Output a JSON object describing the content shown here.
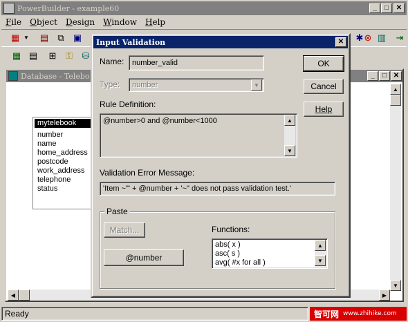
{
  "app": {
    "title": "PowerBuilder - example60"
  },
  "menu": [
    {
      "key": "F",
      "rest": "ile"
    },
    {
      "key": "O",
      "rest": "bject"
    },
    {
      "key": "D",
      "rest": "esign"
    },
    {
      "key": "W",
      "rest": "indow"
    },
    {
      "key": "H",
      "rest": "elp"
    }
  ],
  "child_window": {
    "title": "Database - Telebo"
  },
  "table": {
    "name": "mytelebook",
    "columns": [
      "number",
      "name",
      "home_address",
      "postcode",
      "work_address",
      "telephone",
      "status"
    ]
  },
  "dialog": {
    "title": "Input Validation",
    "name_label": "Name:",
    "name_value": "number_valid",
    "type_label": "Type:",
    "type_value": "number",
    "rule_label": "Rule Definition:",
    "rule_value": "@number>0 and @number<1000",
    "error_label": "Validation Error Message:",
    "error_value": "'Item ~\"' + @number + '~\" does not pass validation test.'",
    "ok": "OK",
    "cancel": "Cancel",
    "help": "Help",
    "paste_label": "Paste",
    "match_button": "Match...",
    "number_button": "@number",
    "functions_label": "Functions:",
    "functions": [
      "abs( x )",
      "asc( s )",
      "avg( #x for all )"
    ]
  },
  "status": {
    "text": "Ready"
  },
  "watermark": {
    "brand": "智可网",
    "url": "www.zhihike.com"
  }
}
